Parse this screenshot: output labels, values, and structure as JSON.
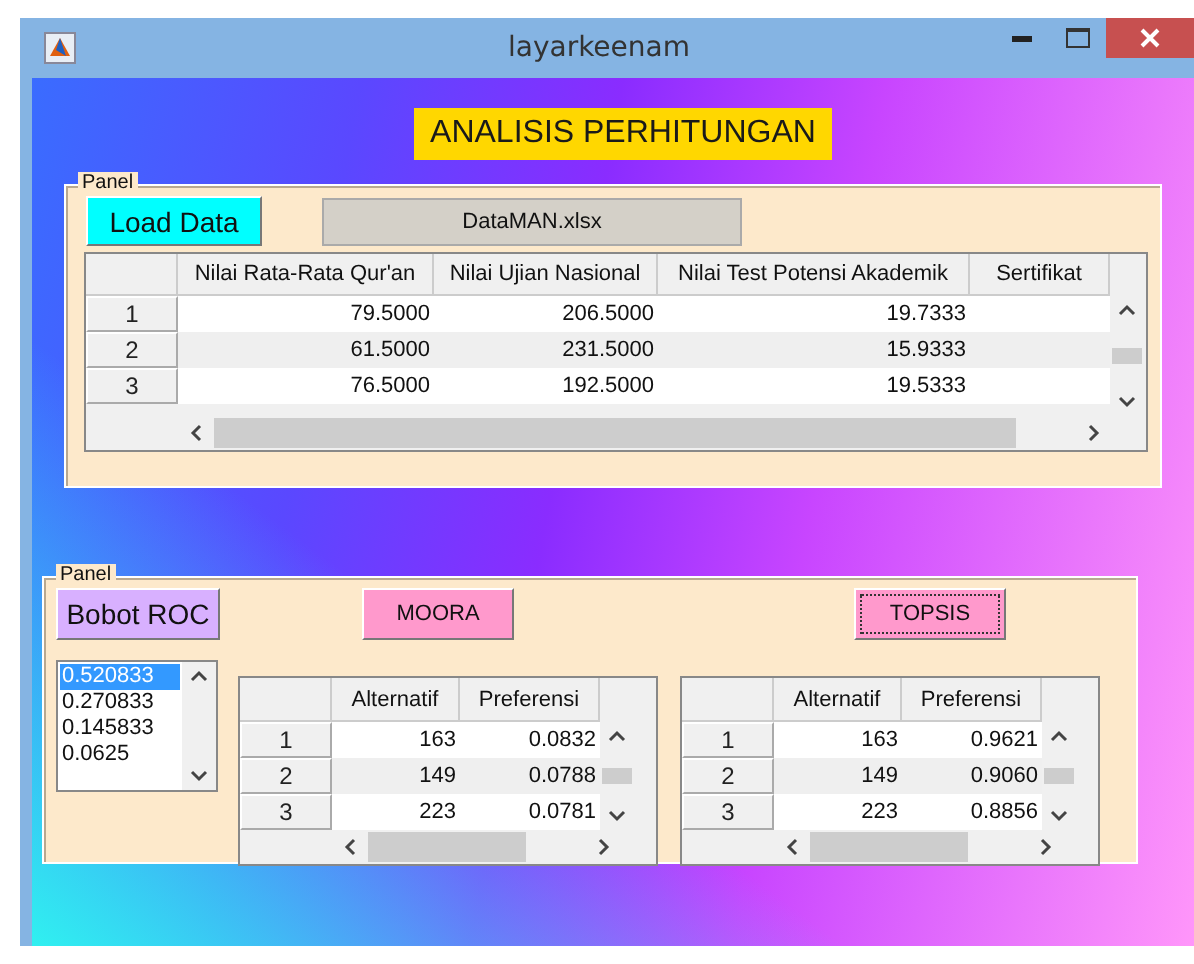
{
  "window": {
    "title": "layarkeenam"
  },
  "heading": "ANALISIS PERHITUNGAN",
  "data_panel": {
    "title": "Panel",
    "load_button": {
      "label": "Load Data",
      "focused": false
    },
    "file_name": "DataMAN.xlsx",
    "table": {
      "columns": [
        "Nilai Rata-Rata Qur'an",
        "Nilai Ujian Nasional",
        "Nilai Test Potensi Akademik",
        "Sertifikat"
      ],
      "rows": [
        {
          "index": "1",
          "cells": [
            "79.5000",
            "206.5000",
            "19.7333"
          ]
        },
        {
          "index": "2",
          "cells": [
            "61.5000",
            "231.5000",
            "15.9333"
          ]
        },
        {
          "index": "3",
          "cells": [
            "76.5000",
            "192.5000",
            "19.5333"
          ]
        }
      ]
    }
  },
  "result_panel": {
    "title": "Panel",
    "roc_button": {
      "label": "Bobot ROC",
      "focused": false
    },
    "weights": [
      {
        "value": "0.520833",
        "selected": true
      },
      {
        "value": "0.270833",
        "selected": false
      },
      {
        "value": "0.145833",
        "selected": false
      },
      {
        "value": "0.0625",
        "selected": false
      }
    ],
    "methods": [
      {
        "button": {
          "label": "MOORA",
          "focused": false
        },
        "table": {
          "columns": [
            "Alternatif",
            "Preferensi"
          ],
          "rows": [
            {
              "index": "1",
              "cells": [
                "163",
                "0.0832"
              ]
            },
            {
              "index": "2",
              "cells": [
                "149",
                "0.0788"
              ]
            },
            {
              "index": "3",
              "cells": [
                "223",
                "0.0781"
              ]
            }
          ]
        }
      },
      {
        "button": {
          "label": "TOPSIS",
          "focused": true
        },
        "table": {
          "columns": [
            "Alternatif",
            "Preferensi"
          ],
          "rows": [
            {
              "index": "1",
              "cells": [
                "163",
                "0.9621"
              ]
            },
            {
              "index": "2",
              "cells": [
                "149",
                "0.9060"
              ]
            },
            {
              "index": "3",
              "cells": [
                "223",
                "0.8856"
              ]
            }
          ]
        }
      }
    ]
  }
}
